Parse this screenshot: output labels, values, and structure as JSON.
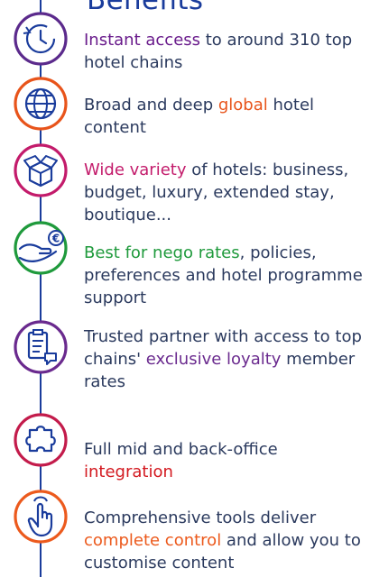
{
  "title": "Benefits",
  "items": [
    {
      "icon": "clock-icon",
      "pre": "",
      "hl": "Instant access",
      "post": " to around 310 top hotel chains"
    },
    {
      "icon": "globe-icon",
      "pre": "Broad and deep ",
      "hl": "global",
      "post": " hotel content"
    },
    {
      "icon": "box-icon",
      "pre": "",
      "hl": "Wide variety",
      "post": " of hotels: business, budget, luxury, extended stay, boutique..."
    },
    {
      "icon": "euro-hand-icon",
      "pre": "",
      "hl": "Best for nego rates",
      "post": ", policies, preferences and hotel programme support"
    },
    {
      "icon": "clipboard-chat-icon",
      "pre": "Trusted partner with access to top chains' ",
      "hl": "exclusive loyalty",
      "post": " member rates"
    },
    {
      "icon": "puzzle-icon",
      "pre": "Full mid and back-office ",
      "hl": "integration",
      "post": ""
    },
    {
      "icon": "hand-pointer-icon",
      "pre": "Comprehensive tools deliver ",
      "hl": "complete control",
      "post": " and allow you to customise content"
    }
  ],
  "colors": {
    "title": "#1a3c9c",
    "text": "#2b3a5e",
    "icon_stroke": "#1a3c9c",
    "ring1": "#5b2a8c",
    "ring2": "#e8541b",
    "ring3": "#c31b6b",
    "ring4": "#1f9a3c",
    "ring5": "#6a2a8e",
    "ring6": "#c31b4b",
    "ring7": "#ec5a1d"
  }
}
